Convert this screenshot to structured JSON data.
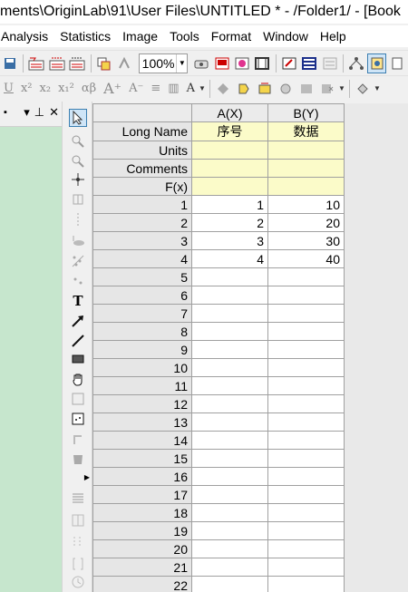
{
  "window": {
    "title": "ments\\OriginLab\\91\\User Files\\UNTITLED * - /Folder1/ - [Book"
  },
  "menu": {
    "items": [
      "Analysis",
      "Statistics",
      "Image",
      "Tools",
      "Format",
      "Window",
      "Help"
    ]
  },
  "toolbar": {
    "zoom_value": "100%"
  },
  "left_panel": {
    "controls": [
      "×",
      "⊥",
      "×"
    ]
  },
  "worksheet": {
    "columns": [
      "A(X)",
      "B(Y)"
    ],
    "header_rows": [
      {
        "label": "Long Name",
        "a": "序号",
        "b": "数据"
      },
      {
        "label": "Units",
        "a": "",
        "b": ""
      },
      {
        "label": "Comments",
        "a": "",
        "b": ""
      },
      {
        "label": "F(x)",
        "a": "",
        "b": ""
      }
    ],
    "rows": [
      {
        "n": "1",
        "a": "1",
        "b": "10"
      },
      {
        "n": "2",
        "a": "2",
        "b": "20"
      },
      {
        "n": "3",
        "a": "3",
        "b": "30"
      },
      {
        "n": "4",
        "a": "4",
        "b": "40"
      },
      {
        "n": "5",
        "a": "",
        "b": ""
      },
      {
        "n": "6",
        "a": "",
        "b": ""
      },
      {
        "n": "7",
        "a": "",
        "b": ""
      },
      {
        "n": "8",
        "a": "",
        "b": ""
      },
      {
        "n": "9",
        "a": "",
        "b": ""
      },
      {
        "n": "10",
        "a": "",
        "b": ""
      },
      {
        "n": "11",
        "a": "",
        "b": ""
      },
      {
        "n": "12",
        "a": "",
        "b": ""
      },
      {
        "n": "13",
        "a": "",
        "b": ""
      },
      {
        "n": "14",
        "a": "",
        "b": ""
      },
      {
        "n": "15",
        "a": "",
        "b": ""
      },
      {
        "n": "16",
        "a": "",
        "b": ""
      },
      {
        "n": "17",
        "a": "",
        "b": ""
      },
      {
        "n": "18",
        "a": "",
        "b": ""
      },
      {
        "n": "19",
        "a": "",
        "b": ""
      },
      {
        "n": "20",
        "a": "",
        "b": ""
      },
      {
        "n": "21",
        "a": "",
        "b": ""
      },
      {
        "n": "22",
        "a": "",
        "b": ""
      }
    ]
  }
}
